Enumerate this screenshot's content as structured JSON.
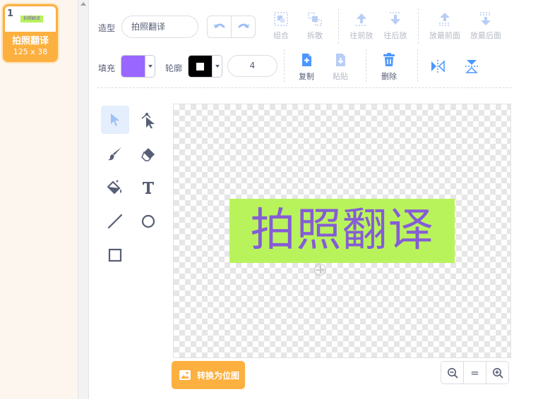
{
  "costume_list": {
    "items": [
      {
        "number": "1",
        "thumb_text": "拍照翻译",
        "name": "拍照翻译",
        "size": "125 x 38"
      }
    ]
  },
  "toolbar": {
    "costume_label": "造型",
    "costume_name": "拍照翻译",
    "group_label": "组合",
    "ungroup_label": "拆散",
    "forward_label": "往前放",
    "backward_label": "往后放",
    "front_label": "放最前面",
    "back_label": "放最后面",
    "fill_label": "填充",
    "outline_label": "轮廓",
    "stroke_width": "4",
    "copy_label": "复制",
    "paste_label": "粘贴",
    "delete_label": "删除"
  },
  "colors": {
    "fill": "#9966ff",
    "outline": "#000000",
    "accent": "#fbb040",
    "text_bg": "#b9f35b",
    "text_color": "#855cd6",
    "icon_blue": "#4c97ff"
  },
  "canvas": {
    "text_object": "拍照翻译"
  },
  "footer": {
    "convert_label": "转换为位图",
    "zoom_reset_label": "="
  }
}
